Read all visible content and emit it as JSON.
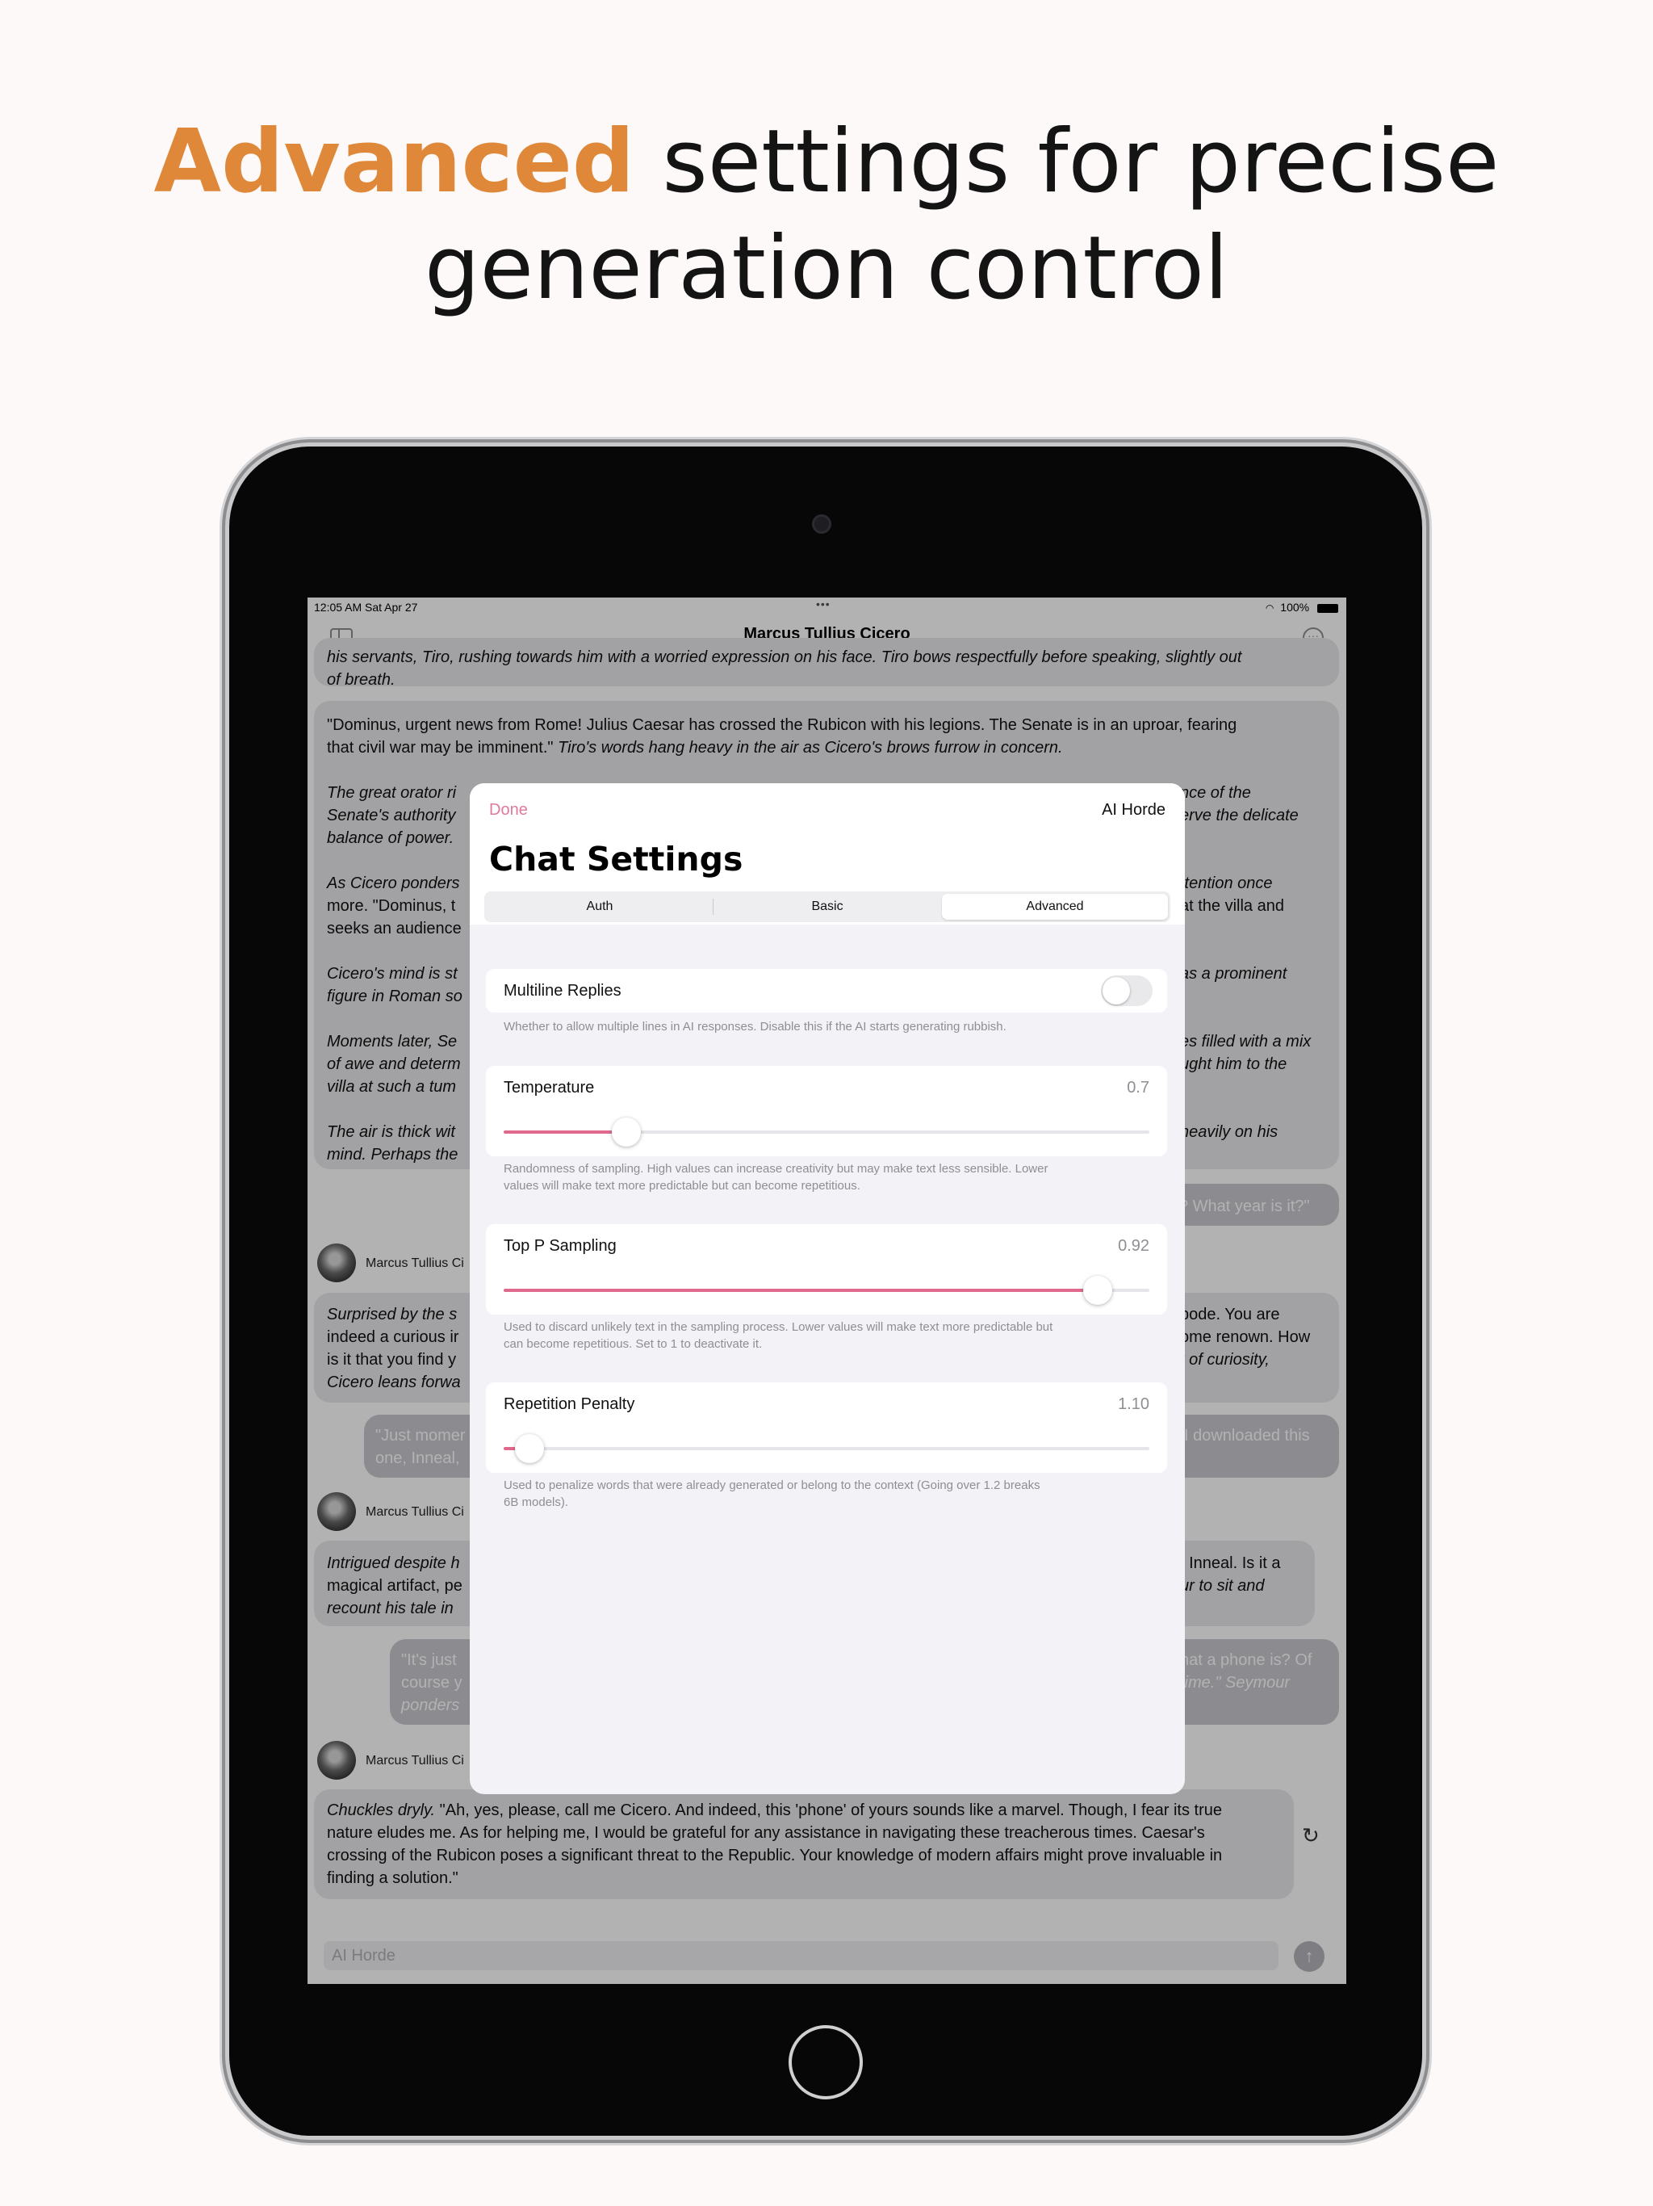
{
  "headline": {
    "accent": "Advanced",
    "rest": " settings for precise",
    "line2": "generation control"
  },
  "status_bar": {
    "time": "12:05 AM  Sat Apr 27",
    "dots": "•••",
    "battery": "100%"
  },
  "nav": {
    "title": "Marcus Tullius Cicero"
  },
  "transcript": {
    "intro_1": "his servants, Tiro, rushing towards him with a worried expression on his face. Tiro bows respectfully before speaking, slightly out",
    "intro_2": "of breath.",
    "dominus_1a": "\"Dominus, urgent news from Rome! Julius Caesar has crossed the Rubicon with his legions. The Senate is in an uproar, fearing",
    "dominus_2a": "that civil war may be imminent.\"",
    "dominus_2b": " Tiro's words hang heavy in the air as Cicero's brows furrow in concern.",
    "orator_1l": "The great orator ri",
    "orator_1r": "nce of the",
    "orator_2l": "Senate's authority",
    "orator_2r": "erve the delicate",
    "orator_3l": "balance of power.",
    "ponders_1l": "As Cicero ponders",
    "ponders_1r": "ttention once",
    "ponders_2l": "more. \"Dominus, t",
    "ponders_2r": "at the villa and",
    "ponders_3l": "seeks an audience",
    "mind_1l": "Cicero's mind is st",
    "mind_1r": "as a prominent",
    "mind_2l": "figure in Roman so",
    "moments_1l": "Moments later, Se",
    "moments_1r": "es filled with a mix",
    "moments_2l": "of awe and determ",
    "moments_2r": "ught him to the",
    "moments_3l": "villa at such a tum",
    "air_1l": "The air is thick wit",
    "air_1r": "heavily on his",
    "air_2l": "mind. Perhaps the",
    "user_q": "? What year is it?\"",
    "sender": "Marcus Tullius Ci",
    "surprised_1l": "Surprised by the s",
    "surprised_1r": "bode. You are",
    "surprised_2l": "indeed a curious ir",
    "surprised_2r": "ome renown. How",
    "surprised_3l": "is it that you find y",
    "surprised_3r": "t of curiosity,",
    "surprised_4l": "Cicero leans forwa",
    "just_1l": "\"Just momer",
    "just_1r": "I downloaded this",
    "just_2l": "one, Inneal,",
    "intrigued_1l": "Intrigued despite h",
    "intrigued_1r": ". Inneal. Is it a",
    "intrigued_2l": "magical artifact, pe",
    "intrigued_2r": "ur to sit and",
    "intrigued_3l": "recount his tale in",
    "its_1l": "\"It's just",
    "its_1r": "hat a phone is? Of",
    "its_2l": "course y",
    "its_2r": "time.\" Seymour",
    "its_3l": "ponders",
    "last_1a": "Chuckles dryly.",
    "last_1b": " \"Ah, yes, please, call me Cicero. And indeed, this 'phone' of yours sounds like a marvel. Though, I fear its true",
    "last_2": "nature eludes me. As for helping me, I would be grateful for any assistance in navigating these treacherous times. Caesar's",
    "last_3": "crossing of the Rubicon poses a significant threat to the Republic. Your knowledge of modern affairs might prove invaluable in",
    "last_4": "finding a solution.\""
  },
  "input": {
    "placeholder": "AI Horde"
  },
  "modal": {
    "done": "Done",
    "provider": "AI Horde",
    "title": "Chat Settings",
    "tabs": [
      "Auth",
      "Basic",
      "Advanced"
    ],
    "selected_tab": "Advanced",
    "multiline": {
      "label": "Multiline Replies",
      "enabled": false,
      "help": "Whether to allow multiple lines in AI responses. Disable this if the AI starts generating rubbish."
    },
    "temperature": {
      "label": "Temperature",
      "value": "0.7",
      "fraction": 0.19,
      "help_1": "Randomness of sampling. High values can increase creativity but may make text less sensible. Lower",
      "help_2": "values will make text more predictable but can become repetitious."
    },
    "top_p": {
      "label": "Top P Sampling",
      "value": "0.92",
      "fraction": 0.92,
      "help_1": "Used to discard unlikely text in the sampling process. Lower values will make text more predictable but",
      "help_2": "can become repetitious. Set to 1 to deactivate it."
    },
    "repetition": {
      "label": "Repetition Penalty",
      "value": "1.10",
      "fraction": 0.04,
      "help_1": "Used to penalize words that were already generated or belong to the context (Going over 1.2 breaks",
      "help_2": "6B models)."
    }
  },
  "colors": {
    "accent": "#e0883a",
    "slider": "#e06a8e",
    "done": "#e07a9a"
  }
}
